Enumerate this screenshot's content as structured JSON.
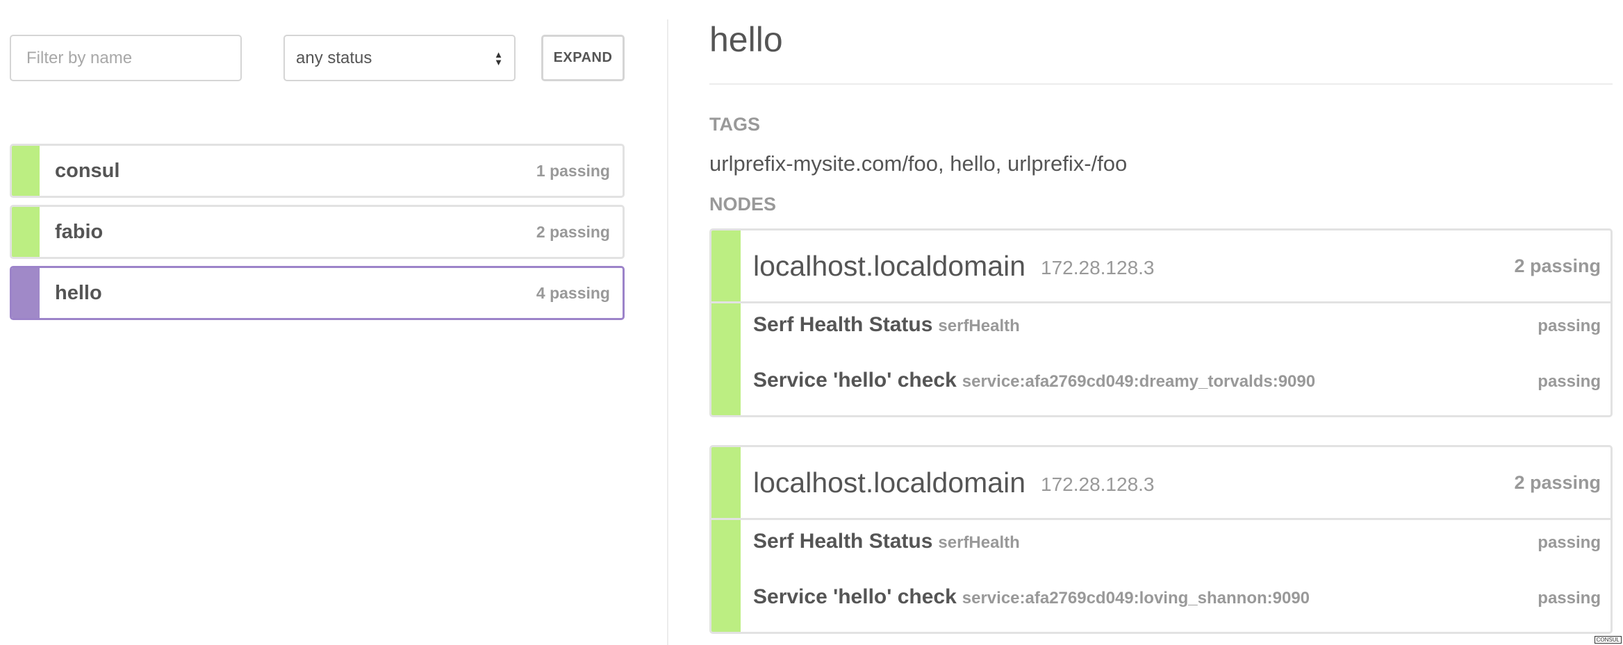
{
  "colors": {
    "passing": "#bcee82",
    "selected": "#a089c8",
    "accent_border": "#9c83c9"
  },
  "filter": {
    "placeholder": "Filter by name",
    "value": ""
  },
  "status_select": {
    "selected": "any status"
  },
  "expand_label": "EXPAND",
  "services": [
    {
      "name": "consul",
      "count": "1 passing",
      "active": false
    },
    {
      "name": "fabio",
      "count": "2 passing",
      "active": false
    },
    {
      "name": "hello",
      "count": "4 passing",
      "active": true
    }
  ],
  "detail": {
    "title": "hello",
    "tags_label": "TAGS",
    "tags": "urlprefix-mysite.com/foo, hello, urlprefix-/foo",
    "nodes_label": "NODES",
    "nodes": [
      {
        "host": "localhost.localdomain",
        "address": "172.28.128.3",
        "count": "2 passing",
        "checks": [
          {
            "name": "Serf Health Status",
            "id": "serfHealth",
            "status": "passing"
          },
          {
            "name": "Service 'hello' check",
            "id": "service:afa2769cd049:dreamy_torvalds:9090",
            "status": "passing"
          }
        ]
      },
      {
        "host": "localhost.localdomain",
        "address": "172.28.128.3",
        "count": "2 passing",
        "checks": [
          {
            "name": "Serf Health Status",
            "id": "serfHealth",
            "status": "passing"
          },
          {
            "name": "Service 'hello' check",
            "id": "service:afa2769cd049:loving_shannon:9090",
            "status": "passing"
          }
        ]
      }
    ]
  },
  "footer_badge": "CONSUL"
}
